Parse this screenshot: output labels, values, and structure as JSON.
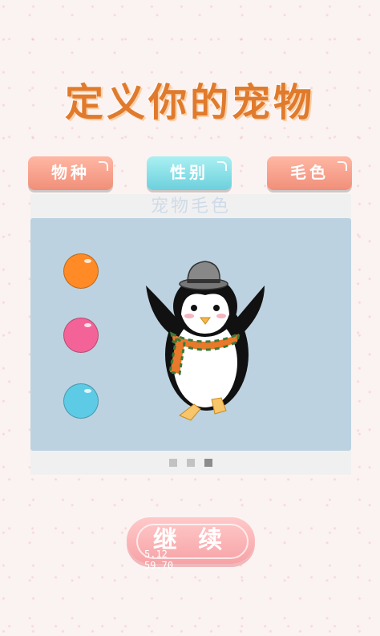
{
  "title": "定义你的宠物",
  "tabs": [
    {
      "label": "物种"
    },
    {
      "label": "性别"
    },
    {
      "label": "毛色"
    }
  ],
  "panel": {
    "title": "宠物毛色",
    "swatches": [
      {
        "name": "orange",
        "color": "#ff8a26"
      },
      {
        "name": "pink",
        "color": "#f46397"
      },
      {
        "name": "blue",
        "color": "#5ecbe6"
      }
    ],
    "page_indicator": {
      "count": 3,
      "active_index": 2
    }
  },
  "continue_label": "继 续",
  "speed_overlay": {
    "line1": "5.12",
    "line2": "59.70"
  },
  "colors": {
    "title": "#e07a2c",
    "stage_bg": "#bcd2e0"
  }
}
